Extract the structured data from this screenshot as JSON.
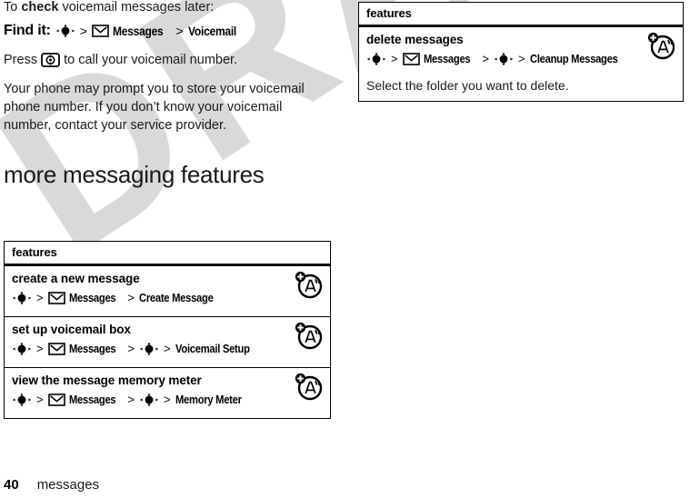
{
  "page": {
    "intro_prefix": "To ",
    "intro_bold": "check",
    "intro_suffix": " voicemail messages later:",
    "find_it_label": "Find it:",
    "press_prefix": "Press",
    "press_suffix": "to call your voicemail number.",
    "note": "Your phone may prompt you to store your voicemail phone number. If you don’t know your voicemail number, contact your service provider.",
    "section_heading": "more messaging features"
  },
  "find_it_path": {
    "joystick_icon": "joystick-icon",
    "separator": ">",
    "envelope_icon": "envelope-icon",
    "messages": "Messages",
    "target": "Voicemail"
  },
  "press_key": {
    "send_key_icon": "send-key-icon"
  },
  "table_left": {
    "header": "features",
    "rows": [
      {
        "title": "create a new message",
        "path": {
          "step1_icon": "joystick-icon",
          "sep1": ">",
          "step2_icon": "envelope-icon",
          "step2": "Messages",
          "sep2": ">",
          "step3": "Create Message"
        },
        "icon": "attachment-airtime-icon"
      },
      {
        "title": "set up voicemail box",
        "path": {
          "step1_icon": "joystick-icon",
          "sep1": ">",
          "step2_icon": "envelope-icon",
          "step2": "Messages",
          "sep2": ">",
          "step3_icon": "joystick-icon",
          "sep3": ">",
          "step4": "Voicemail Setup"
        },
        "icon": "attachment-airtime-icon"
      },
      {
        "title": "view the message memory meter",
        "path": {
          "step1_icon": "joystick-icon",
          "sep1": ">",
          "step2_icon": "envelope-icon",
          "step2": "Messages",
          "sep2": ">",
          "step3_icon": "joystick-icon",
          "sep3": ">",
          "step4": "Memory Meter"
        },
        "icon": "attachment-airtime-icon"
      }
    ]
  },
  "table_right": {
    "header": "features",
    "rows": [
      {
        "title": "delete messages",
        "path": {
          "step1_icon": "joystick-icon",
          "sep1": ">",
          "step2_icon": "envelope-icon",
          "step2": "Messages",
          "sep2": ">",
          "step3_icon": "joystick-icon",
          "sep3": ">",
          "step4": "Cleanup Messages"
        },
        "description": "Select the folder you want to delete.",
        "icon": "attachment-airtime-icon"
      }
    ]
  },
  "footer": {
    "page_number": "40",
    "section_label": "messages"
  },
  "watermark": {
    "text": "DRAFT"
  },
  "colors": {
    "text": "#1a1a1a",
    "rule": "#000000",
    "watermark": "#d9d9d9",
    "background": "#ffffff"
  }
}
